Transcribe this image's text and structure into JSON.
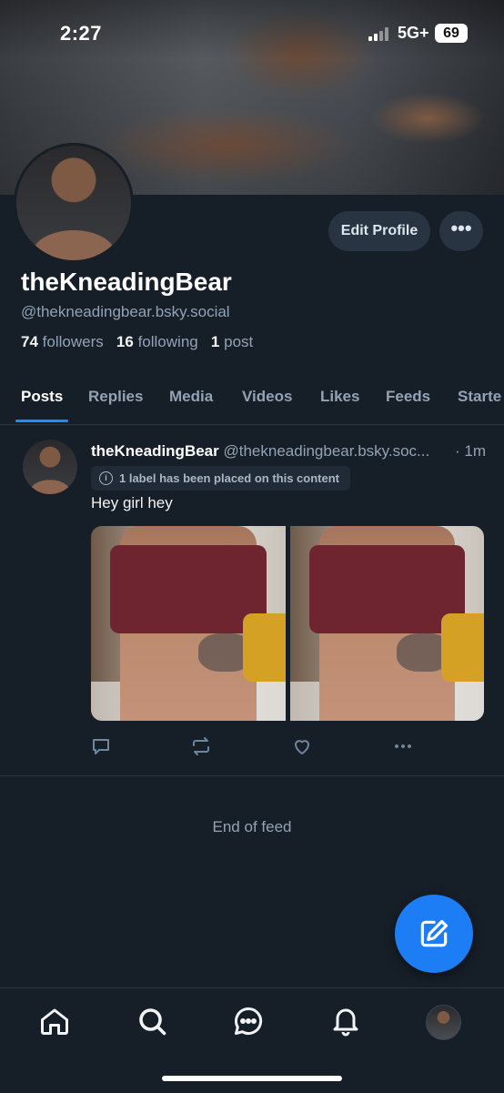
{
  "status_bar": {
    "time": "2:27",
    "network": "5G+",
    "battery": "69"
  },
  "profile": {
    "display_name": "theKneadingBear",
    "handle": "@thekneadingbear.bsky.social",
    "followers_count": "74",
    "followers_label": "followers",
    "following_count": "16",
    "following_label": "following",
    "posts_count": "1",
    "posts_label": "post",
    "edit_button": "Edit Profile",
    "more_button": "•••"
  },
  "tabs": [
    {
      "label": "Posts",
      "active": true
    },
    {
      "label": "Replies"
    },
    {
      "label": "Media"
    },
    {
      "label": "Videos"
    },
    {
      "label": "Likes"
    },
    {
      "label": "Feeds"
    },
    {
      "label": "Starte"
    }
  ],
  "post": {
    "author": "theKneadingBear",
    "handle": "@thekneadingbear.bsky.soc...",
    "time": "· 1m",
    "label_notice": "1 label has been placed on this content",
    "text": "Hey girl hey",
    "image_count": 2
  },
  "feed": {
    "end_text": "End of feed"
  },
  "colors": {
    "accent": "#208bfe",
    "background": "#161e27",
    "fab": "#1d7df5"
  },
  "icons": [
    "reply-icon",
    "repost-icon",
    "like-icon",
    "more-icon",
    "compose-icon",
    "home-icon",
    "search-icon",
    "chat-icon",
    "bell-icon"
  ]
}
